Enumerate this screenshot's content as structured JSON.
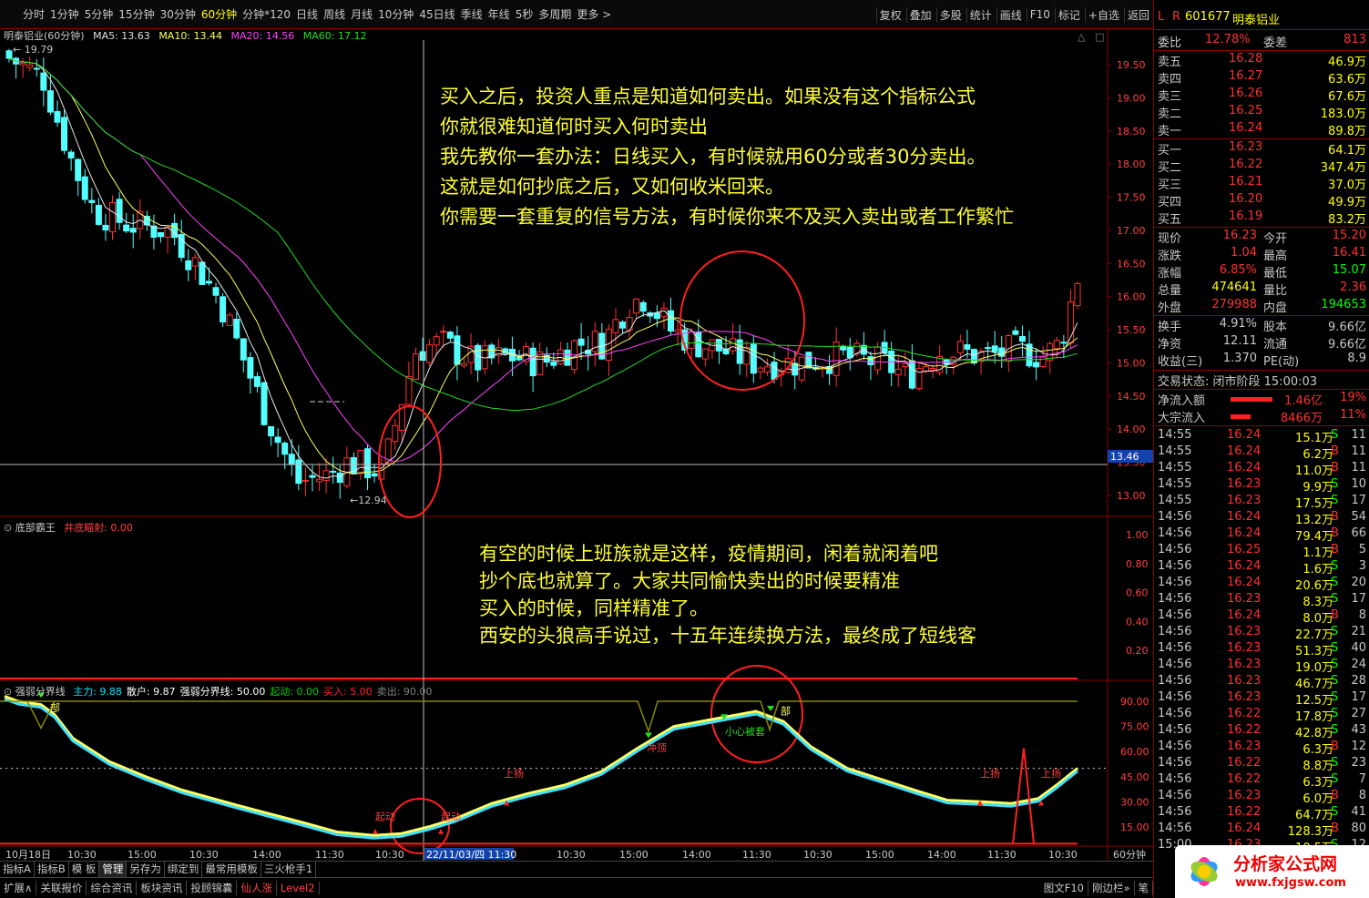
{
  "toolbar": {
    "periods": [
      "分时",
      "1分钟",
      "5分钟",
      "15分钟",
      "30分钟",
      "60分钟",
      "分钟*120",
      "日线",
      "周线",
      "月线",
      "10分钟",
      "45日线",
      "季线",
      "年线",
      "5秒",
      "多周期",
      "更多 >"
    ],
    "active_period": "60分钟",
    "tools": [
      "复权",
      "叠加",
      "多股",
      "统计",
      "画线",
      "F10",
      "标记",
      "+自选",
      "返回"
    ]
  },
  "main_chart": {
    "legend": {
      "stock": "明泰铝业(60分钟)",
      "ma5": "MA5: 13.63",
      "ma10": "MA10: 13.44",
      "ma20": "MA20: 14.56",
      "ma60": "MA60: 17.12"
    },
    "high_label": "19.79",
    "low_label": "12.94",
    "y_ticks": [
      "19.50",
      "19.00",
      "18.50",
      "18.00",
      "17.50",
      "17.00",
      "16.50",
      "16.00",
      "15.50",
      "15.00",
      "14.50",
      "14.00",
      "13.50",
      "13.00"
    ],
    "cursor_price": "13.46",
    "notes": [
      "买入之后，投资人重点是知道如何卖出。如果没有这个指标公式",
      "你就很难知道何时买入何时卖出",
      "我先教你一套办法：日线买入，有时候就用60分或者30分卖出。",
      "这就是如何抄底之后，又如何收米回来。",
      "你需要一套重复的信号方法，有时候你来不及买入卖出或者工作繁忙"
    ]
  },
  "panel2": {
    "title": "底部霸王",
    "field": "井底瞄射: 0.00",
    "y_ticks": [
      "1.00",
      "0.80",
      "0.60",
      "0.40",
      "0.20"
    ],
    "notes": [
      "有空的时候上班族就是这样，疫情期间，闲着就闲着吧",
      "抄个底也就算了。大家共同愉快卖出的时候要精准",
      "买入的时候，同样精准了。",
      "西安的头狼高手说过，十五年连续换方法，最终成了短线客"
    ]
  },
  "panel3": {
    "title": "强弱分界线",
    "fields": [
      {
        "label": "主力: 9.88",
        "color": "#00e5ff"
      },
      {
        "label": "散户: 9.87",
        "color": "#ffffff"
      },
      {
        "label": "强弱分界线: 50.00",
        "color": "#ffffff"
      },
      {
        "label": "起动: 0.00",
        "color": "#00cc00"
      },
      {
        "label": "买入: 5.00",
        "color": "#ff2020"
      },
      {
        "label": "卖出: 90.00",
        "color": "#808080"
      }
    ],
    "y_ticks": [
      "90.00",
      "75.00",
      "60.00",
      "45.00",
      "30.00",
      "15.00"
    ],
    "signals": {
      "top1": "部",
      "top2": "部",
      "qidong1": "起动",
      "qidong2": "起动",
      "shangyang1": "上扬",
      "chongding": "冲顶",
      "xiaoxin": "小心被套",
      "shangyang2": "上扬",
      "shangyang3": "上扬"
    }
  },
  "x_axis": {
    "labels": [
      "10月18日",
      "10:30",
      "15:00",
      "10:30",
      "14:00",
      "11:30",
      "10:30",
      "15:00",
      "11/03/四 11:30",
      "10:30",
      "15:00",
      "14:00",
      "11:30",
      "10:30",
      "15:00",
      "14:00",
      "11:30",
      "10:30"
    ],
    "cursor_label": "22/11/03/四 11:30",
    "period": "60分钟"
  },
  "quote": {
    "code": "601677",
    "name": "明泰铝业",
    "weibi_label": "委比",
    "weibi": "12.78%",
    "weicha_label": "委差",
    "weicha": "813",
    "asks": [
      {
        "label": "卖五",
        "price": "16.28",
        "vol": "46.9万"
      },
      {
        "label": "卖四",
        "price": "16.27",
        "vol": "63.6万"
      },
      {
        "label": "卖三",
        "price": "16.26",
        "vol": "67.6万"
      },
      {
        "label": "卖二",
        "price": "16.25",
        "vol": "183.0万"
      },
      {
        "label": "卖一",
        "price": "16.24",
        "vol": "89.8万"
      }
    ],
    "bids": [
      {
        "label": "买一",
        "price": "16.23",
        "vol": "64.1万"
      },
      {
        "label": "买二",
        "price": "16.22",
        "vol": "347.4万"
      },
      {
        "label": "买三",
        "price": "16.21",
        "vol": "37.0万"
      },
      {
        "label": "买四",
        "price": "16.20",
        "vol": "49.9万"
      },
      {
        "label": "买五",
        "price": "16.19",
        "vol": "83.2万"
      }
    ],
    "stats": [
      {
        "l": "现价",
        "v": "16.23",
        "l2": "今开",
        "v2": "15.20",
        "c": "#ff3030",
        "c2": "#ff3030"
      },
      {
        "l": "涨跌",
        "v": "1.04",
        "l2": "最高",
        "v2": "16.41",
        "c": "#ff3030",
        "c2": "#ff3030"
      },
      {
        "l": "涨幅",
        "v": "6.85%",
        "l2": "最低",
        "v2": "15.07",
        "c": "#ff3030",
        "c2": "#00ff00"
      },
      {
        "l": "总量",
        "v": "474641",
        "l2": "量比",
        "v2": "2.36",
        "c": "#ffff00",
        "c2": "#ff3030"
      },
      {
        "l": "外盘",
        "v": "279988",
        "l2": "内盘",
        "v2": "194653",
        "c": "#ff3030",
        "c2": "#00ff00"
      }
    ],
    "stats2": [
      {
        "l": "换手",
        "v": "4.91%",
        "l2": "股本",
        "v2": "9.66亿"
      },
      {
        "l": "净资",
        "v": "12.11",
        "l2": "流通",
        "v2": "9.66亿"
      },
      {
        "l": "收益(三)",
        "v": "1.370",
        "l2": "PE(动)",
        "v2": "8.9"
      }
    ],
    "trade_status": "交易状态: 闭市阶段 15:00:03",
    "net_inflow": {
      "label": "净流入额",
      "value": "1.46亿",
      "pct": "19%"
    },
    "block_inflow": {
      "label": "大宗流入",
      "value": "8466万",
      "pct": "11%"
    },
    "ticks": [
      {
        "t": "14:55",
        "p": "16.24",
        "v": "15.1万",
        "d": "S",
        "n": "11"
      },
      {
        "t": "14:55",
        "p": "16.24",
        "v": "6.2万",
        "d": "B",
        "n": "11"
      },
      {
        "t": "14:55",
        "p": "16.24",
        "v": "11.0万",
        "d": "B",
        "n": "11"
      },
      {
        "t": "14:55",
        "p": "16.23",
        "v": "9.9万",
        "d": "S",
        "n": "10"
      },
      {
        "t": "14:55",
        "p": "16.23",
        "v": "17.5万",
        "d": "S",
        "n": "17"
      },
      {
        "t": "14:56",
        "p": "16.24",
        "v": "13.2万",
        "d": "B",
        "n": "54"
      },
      {
        "t": "14:56",
        "p": "16.24",
        "v": "79.4万",
        "d": "B",
        "n": "66"
      },
      {
        "t": "14:56",
        "p": "16.25",
        "v": "1.1万",
        "d": "B",
        "n": "5"
      },
      {
        "t": "14:56",
        "p": "16.24",
        "v": "1.6万",
        "d": "S",
        "n": "3"
      },
      {
        "t": "14:56",
        "p": "16.24",
        "v": "20.6万",
        "d": "S",
        "n": "20"
      },
      {
        "t": "14:56",
        "p": "16.23",
        "v": "8.3万",
        "d": "S",
        "n": "17"
      },
      {
        "t": "14:56",
        "p": "16.24",
        "v": "8.0万",
        "d": "B",
        "n": "8"
      },
      {
        "t": "14:56",
        "p": "16.23",
        "v": "22.7万",
        "d": "S",
        "n": "21"
      },
      {
        "t": "14:56",
        "p": "16.23",
        "v": "51.3万",
        "d": "S",
        "n": "40"
      },
      {
        "t": "14:56",
        "p": "16.23",
        "v": "19.0万",
        "d": "S",
        "n": "24"
      },
      {
        "t": "14:56",
        "p": "16.23",
        "v": "46.7万",
        "d": "S",
        "n": "28"
      },
      {
        "t": "14:56",
        "p": "16.23",
        "v": "12.5万",
        "d": "S",
        "n": "17"
      },
      {
        "t": "14:56",
        "p": "16.22",
        "v": "17.8万",
        "d": "S",
        "n": "27"
      },
      {
        "t": "14:56",
        "p": "16.22",
        "v": "42.8万",
        "d": "S",
        "n": "43"
      },
      {
        "t": "14:56",
        "p": "16.23",
        "v": "6.3万",
        "d": "B",
        "n": "12"
      },
      {
        "t": "14:56",
        "p": "16.22",
        "v": "8.8万",
        "d": "S",
        "n": "23"
      },
      {
        "t": "14:56",
        "p": "16.22",
        "v": "6.3万",
        "d": "S",
        "n": "7"
      },
      {
        "t": "14:56",
        "p": "16.23",
        "v": "6.0万",
        "d": "B",
        "n": "8"
      },
      {
        "t": "14:56",
        "p": "16.22",
        "v": "64.7万",
        "d": "S",
        "n": "41"
      },
      {
        "t": "14:56",
        "p": "16.24",
        "v": "128.3万",
        "d": "B",
        "n": "80"
      },
      {
        "t": "15:00",
        "p": "16.23",
        "v": "10.5万",
        "d": "S",
        "n": "12"
      }
    ]
  },
  "bottom": {
    "tabs1": [
      "指标A",
      "指标B",
      "模 板",
      "管理",
      "另存为",
      "绑定到",
      "最常用模板",
      "三火枪手1"
    ],
    "active_tab1": "管理",
    "tabs2": [
      "扩展∧",
      "关联报价",
      "综合资讯",
      "板块资讯",
      "投顾锦囊",
      "仙人涨",
      "Level2"
    ],
    "right1": "图文F10",
    "right2": "刚边栏»",
    "right3": "笔"
  },
  "watermark": {
    "line1": "分析家公式网",
    "line2": "www.fxjgsw.com"
  }
}
